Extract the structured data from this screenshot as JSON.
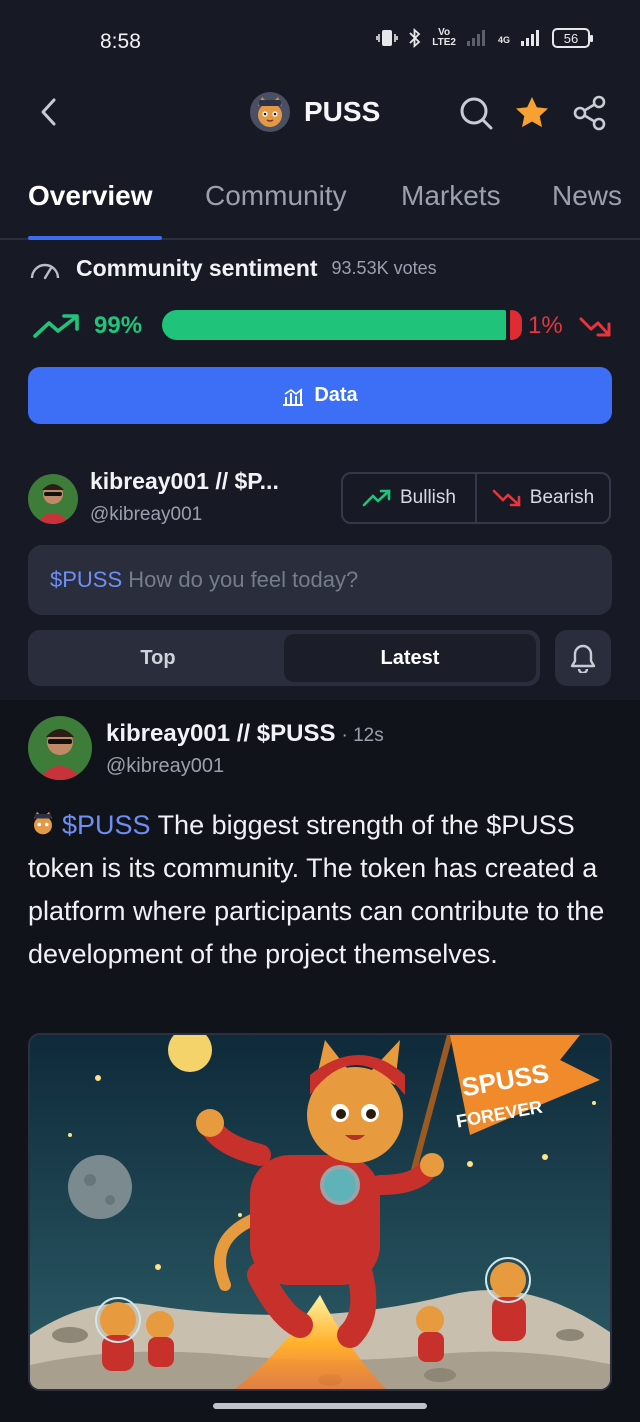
{
  "status_bar": {
    "time": "8:58",
    "lte_top": "Vo",
    "lte_bottom": "LTE2",
    "network": "4G",
    "battery": "56"
  },
  "header": {
    "title": "PUSS"
  },
  "tabs": [
    {
      "label": "Overview",
      "active": true
    },
    {
      "label": "Community",
      "active": false
    },
    {
      "label": "Markets",
      "active": false
    },
    {
      "label": "News",
      "active": false
    }
  ],
  "sentiment": {
    "title": "Community sentiment",
    "votes": "93.53K votes",
    "bullish_pct": "99%",
    "bearish_pct": "1%",
    "bullish_fraction": 0.99
  },
  "data_button": {
    "label": "Data"
  },
  "current_user": {
    "name": "kibreay001 // $P...",
    "handle": "@kibreay001"
  },
  "vote_buttons": {
    "bullish": "Bullish",
    "bearish": "Bearish"
  },
  "compose": {
    "tag": "$PUSS",
    "placeholder": "How do you feel today?"
  },
  "sort": {
    "top": "Top",
    "latest": "Latest",
    "active": "Latest"
  },
  "post": {
    "author": "kibreay001 // $PUSS",
    "time": "· 12s",
    "handle": "@kibreay001",
    "tag": "$PUSS",
    "body": "The biggest strength of the $PUSS token is its community. The token has created a platform where participants can contribute to the development of the project themselves.",
    "image_flag_text": [
      "SPUSS",
      "FOREVER"
    ]
  },
  "colors": {
    "accent": "#3c6ef6",
    "bullish": "#1fc47a",
    "bearish": "#e02b34",
    "background": "#171a24"
  },
  "icons": [
    "back-icon",
    "search-icon",
    "star-icon",
    "share-icon",
    "gauge-icon",
    "trend-up-icon",
    "trend-down-icon",
    "chart-icon",
    "bell-icon"
  ]
}
